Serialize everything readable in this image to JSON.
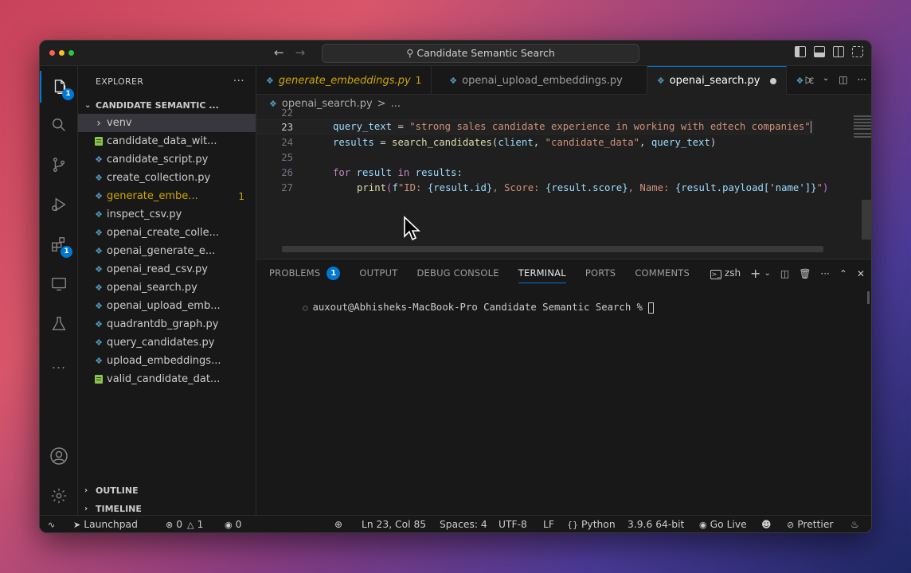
{
  "window": {
    "title": "Candidate Semantic Search"
  },
  "sidebar": {
    "header": "EXPLORER",
    "folder": "CANDIDATE SEMANTIC ...",
    "items": [
      {
        "label": "venv",
        "type": "folder"
      },
      {
        "label": "candidate_data_wit...",
        "type": "csv"
      },
      {
        "label": "candidate_script.py",
        "type": "py"
      },
      {
        "label": "create_collection.py",
        "type": "py"
      },
      {
        "label": "generate_embe...",
        "type": "py",
        "count": "1"
      },
      {
        "label": "inspect_csv.py",
        "type": "py"
      },
      {
        "label": "openai_create_colle...",
        "type": "py"
      },
      {
        "label": "openai_generate_e...",
        "type": "py"
      },
      {
        "label": "openai_read_csv.py",
        "type": "py"
      },
      {
        "label": "openai_search.py",
        "type": "py"
      },
      {
        "label": "openai_upload_emb...",
        "type": "py"
      },
      {
        "label": "quadrantdb_graph.py",
        "type": "py"
      },
      {
        "label": "query_candidates.py",
        "type": "py"
      },
      {
        "label": "upload_embeddings...",
        "type": "py"
      },
      {
        "label": "valid_candidate_dat...",
        "type": "csv"
      }
    ],
    "outline": "OUTLINE",
    "timeline": "TIMELINE"
  },
  "activity": {
    "explorer_badge": "1",
    "extensions_badge": "1",
    "more": "..."
  },
  "tabs": [
    {
      "label": "generate_embeddings.py",
      "count": "1"
    },
    {
      "label": "openai_upload_embeddings.py"
    },
    {
      "label": "openai_search.py"
    },
    {
      "label": "c"
    }
  ],
  "breadcrumb": {
    "file": "openai_search.py",
    "sep": ">",
    "more": "..."
  },
  "editor": {
    "line_numbers": [
      "22",
      "23",
      "24",
      "25",
      "26",
      "27"
    ],
    "line23": {
      "var": "query_text",
      "op": " = ",
      "str": "\"strong sales candidate experience in working with edtech companies\""
    },
    "line24": {
      "var": "results",
      "op": " = ",
      "fn": "search_candidates",
      "args_open": "(",
      "arg1": "client",
      "comma": ", ",
      "arg2": "\"candidate_data\"",
      "comma2": ", ",
      "arg3": "query_text",
      "args_close": ")"
    },
    "line26": {
      "kw_for": "for",
      "var": " result ",
      "kw_in": "in",
      "rest": " results:"
    },
    "line27": {
      "fn": "print",
      "open": "(",
      "f": "f",
      "s1": "\"ID: ",
      "e1": "{result.id}",
      "s2": ", Score: ",
      "e2": "{result.score}",
      "s3": ", Name: ",
      "e3": "{result.payload['name']}",
      "s4": "\"",
      "close": ")"
    }
  },
  "panel": {
    "tabs": [
      "PROBLEMS",
      "OUTPUT",
      "DEBUG CONSOLE",
      "TERMINAL",
      "PORTS",
      "COMMENTS"
    ],
    "problems_badge": "1",
    "shell": "zsh",
    "prompt": "auxout@Abhisheks-MacBook-Pro Candidate Semantic Search % "
  },
  "statusbar": {
    "launchpad": "Launchpad",
    "errors": "0",
    "warnings": "1",
    "ports": "0",
    "position": "Ln 23, Col 85",
    "spaces": "Spaces: 4",
    "encoding": "UTF-8",
    "eol": "LF",
    "language": "Python",
    "interpreter": "3.9.6 64-bit",
    "golive": "Go Live",
    "prettier": "Prettier"
  },
  "colors": {
    "accent": "#0078d4",
    "warning": "#cca700",
    "traffic_red": "#ff5f57",
    "traffic_yellow": "#febc2e",
    "traffic_green": "#28c840"
  }
}
